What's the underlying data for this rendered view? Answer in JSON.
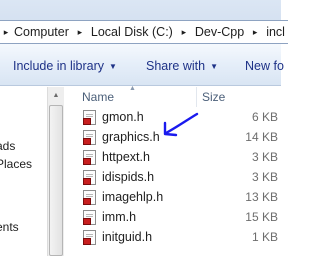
{
  "address": {
    "crumbs": [
      "Computer",
      "Local Disk (C:)",
      "Dev-Cpp",
      "incl"
    ]
  },
  "toolbar": {
    "include_label": "Include in library",
    "share_label": "Share with",
    "new_folder_label": "New fo"
  },
  "nav": {
    "items": [
      "ads",
      "Places",
      "ents"
    ]
  },
  "columns": {
    "name": "Name",
    "size": "Size"
  },
  "files": [
    {
      "name": "gmon.h",
      "size": "6 KB"
    },
    {
      "name": "graphics.h",
      "size": "14 KB"
    },
    {
      "name": "httpext.h",
      "size": "3 KB"
    },
    {
      "name": "idispids.h",
      "size": "3 KB"
    },
    {
      "name": "imagehlp.h",
      "size": "13 KB"
    },
    {
      "name": "imm.h",
      "size": "15 KB"
    },
    {
      "name": "initguid.h",
      "size": "1 KB"
    }
  ],
  "annotation": {
    "color": "#1a1aee"
  },
  "colors": {
    "toolbar_text": "#1e3287",
    "header_text": "#4c607a",
    "file_badge": "#c81e1e"
  }
}
